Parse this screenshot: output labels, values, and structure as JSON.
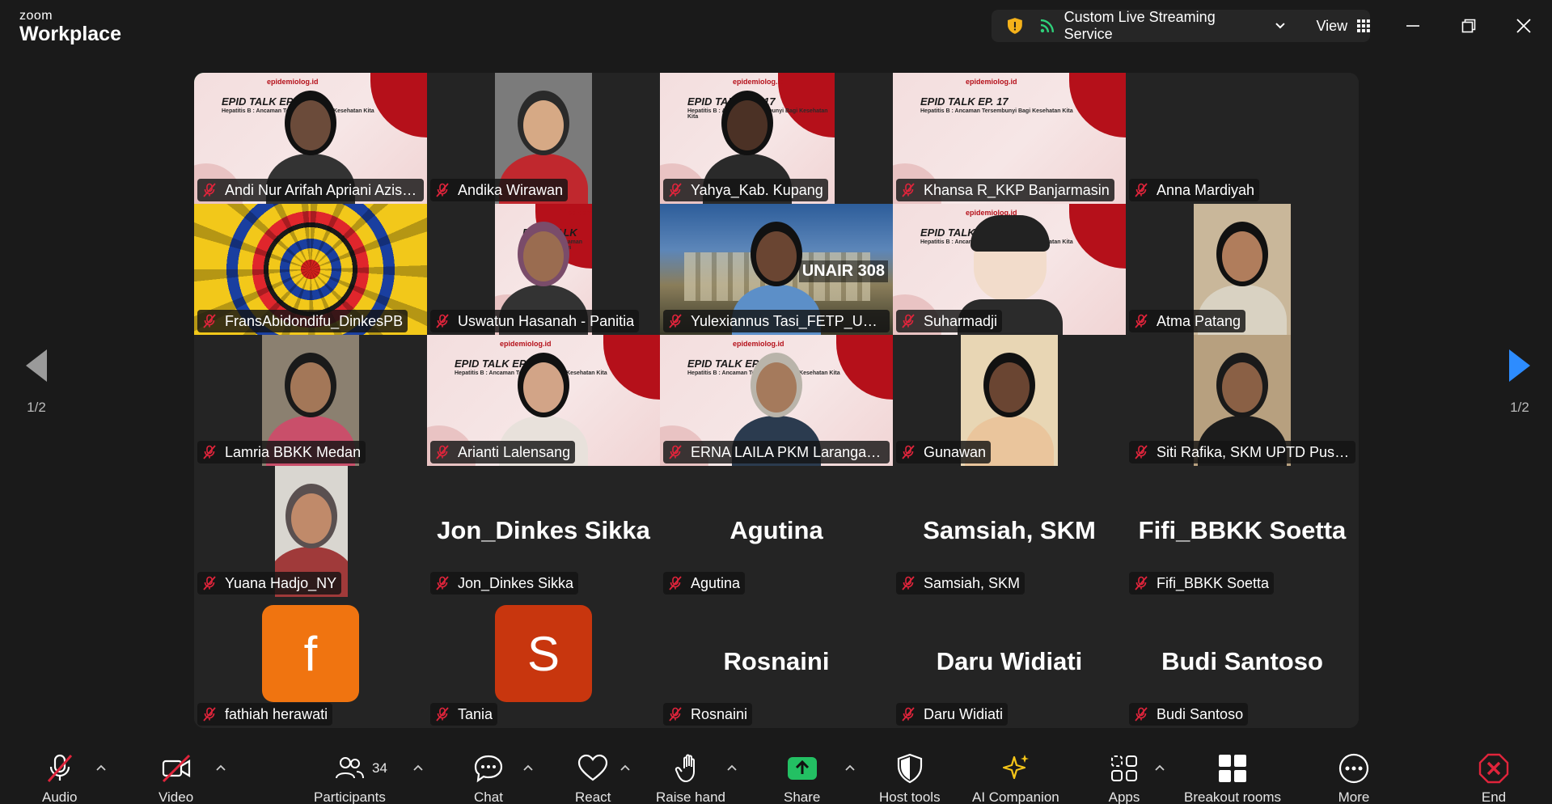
{
  "app": {
    "logo_top": "zoom",
    "logo_bottom": "Workplace"
  },
  "stream": {
    "label": "Custom Live Streaming Service",
    "view_label": "View"
  },
  "pager": {
    "left": "1/2",
    "right": "1/2"
  },
  "participants": [
    {
      "name": "Andi Nur Arifah Apriani Azis_H...",
      "kind": "slide",
      "active": true
    },
    {
      "name": "Andika Wirawan",
      "kind": "video"
    },
    {
      "name": "Yahya_Kab. Kupang",
      "kind": "slide"
    },
    {
      "name": "Khansa R_KKP Banjarmasin",
      "kind": "slide"
    },
    {
      "name": "Anna Mardiyah",
      "kind": "blank"
    },
    {
      "name": "FransAbidondifu_DinkesPB",
      "kind": "pattern"
    },
    {
      "name": "Uswatun Hasanah - Panitia",
      "kind": "slide"
    },
    {
      "name": "Yulexiannus Tasi_FETP_UNAI...",
      "kind": "video"
    },
    {
      "name": "Suharmadji",
      "kind": "slide"
    },
    {
      "name": "Atma Patang",
      "kind": "video"
    },
    {
      "name": "Lamria BBKK Medan",
      "kind": "video"
    },
    {
      "name": "Arianti Lalensang",
      "kind": "slide"
    },
    {
      "name": "ERNA LAILA PKM Larangan ...",
      "kind": "slide"
    },
    {
      "name": "Gunawan",
      "kind": "video"
    },
    {
      "name": "Siti Rafika, SKM UPTD Puske...",
      "kind": "video"
    },
    {
      "name": "Yuana Hadjo_NY",
      "kind": "video"
    },
    {
      "name": "Jon_Dinkes Sikka",
      "kind": "name",
      "display": "Jon_Dinkes Sikka"
    },
    {
      "name": "Agutina",
      "kind": "name",
      "display": "Agutina"
    },
    {
      "name": "Samsiah, SKM",
      "kind": "name",
      "display": "Samsiah, SKM"
    },
    {
      "name": "Fifi_BBKK Soetta",
      "kind": "name",
      "display": "Fifi_BBKK Soetta"
    },
    {
      "name": "fathiah herawati",
      "kind": "avatar",
      "letter": "f",
      "color": "#f07410"
    },
    {
      "name": "Tania",
      "kind": "avatar",
      "letter": "S",
      "color": "#c8360e"
    },
    {
      "name": "Rosnaini",
      "kind": "name",
      "display": "Rosnaini"
    },
    {
      "name": "Daru Widiati",
      "kind": "name",
      "display": "Daru Widiati"
    },
    {
      "name": "Budi Santoso",
      "kind": "name",
      "display": "Budi Santoso"
    }
  ],
  "slide_text": {
    "title": "EPID TALK EP. 17",
    "subtitle": "Hepatitis B : Ancaman Tersembunyi Bagi Kesehatan Kita",
    "brand": "epidemiolog.id",
    "badge": "UNAIR 308"
  },
  "toolbar": {
    "audio": "Audio",
    "video": "Video",
    "participants": "Participants",
    "participants_count": "34",
    "chat": "Chat",
    "react": "React",
    "raise_hand": "Raise hand",
    "share": "Share",
    "host_tools": "Host tools",
    "ai_companion": "AI Companion",
    "apps": "Apps",
    "breakout_rooms": "Breakout rooms",
    "more": "More",
    "end": "End"
  },
  "colors": {
    "active_border": "#2fd07a",
    "share_green": "#23c063",
    "end_red": "#e0243b",
    "muted_red": "#e0243b",
    "ai_yellow": "#f5c518"
  }
}
